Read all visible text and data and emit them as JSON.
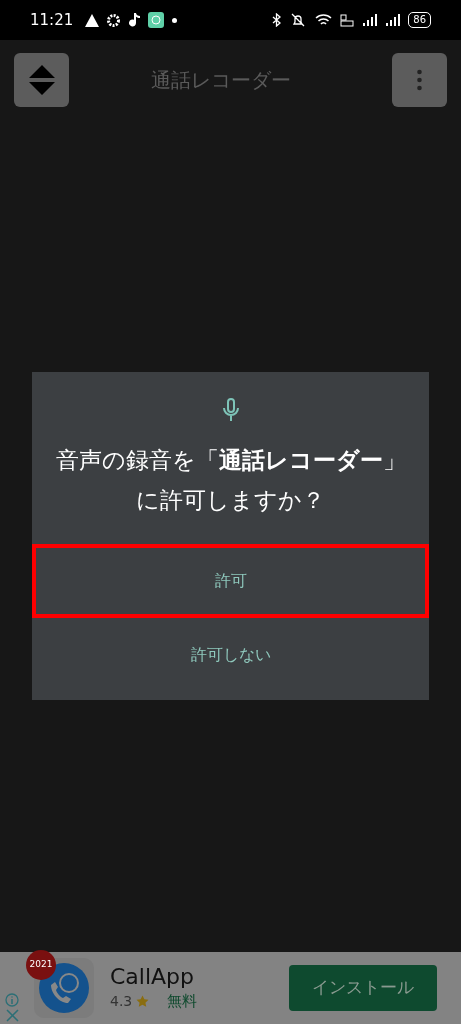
{
  "status_bar": {
    "time": "11:21",
    "battery": "86"
  },
  "app_bar": {
    "title": "通話レコーダー"
  },
  "dialog": {
    "message": "音声の録音を「**通話レコーダー**」に許可しますか？",
    "buttons": [
      {
        "label": "許可",
        "highlighted": true
      },
      {
        "label": "許可しない",
        "highlighted": false
      }
    ]
  },
  "ad": {
    "badge": "2021",
    "app_name": "CallApp",
    "rating": "4.3",
    "price": "無料",
    "install": "インストール"
  }
}
